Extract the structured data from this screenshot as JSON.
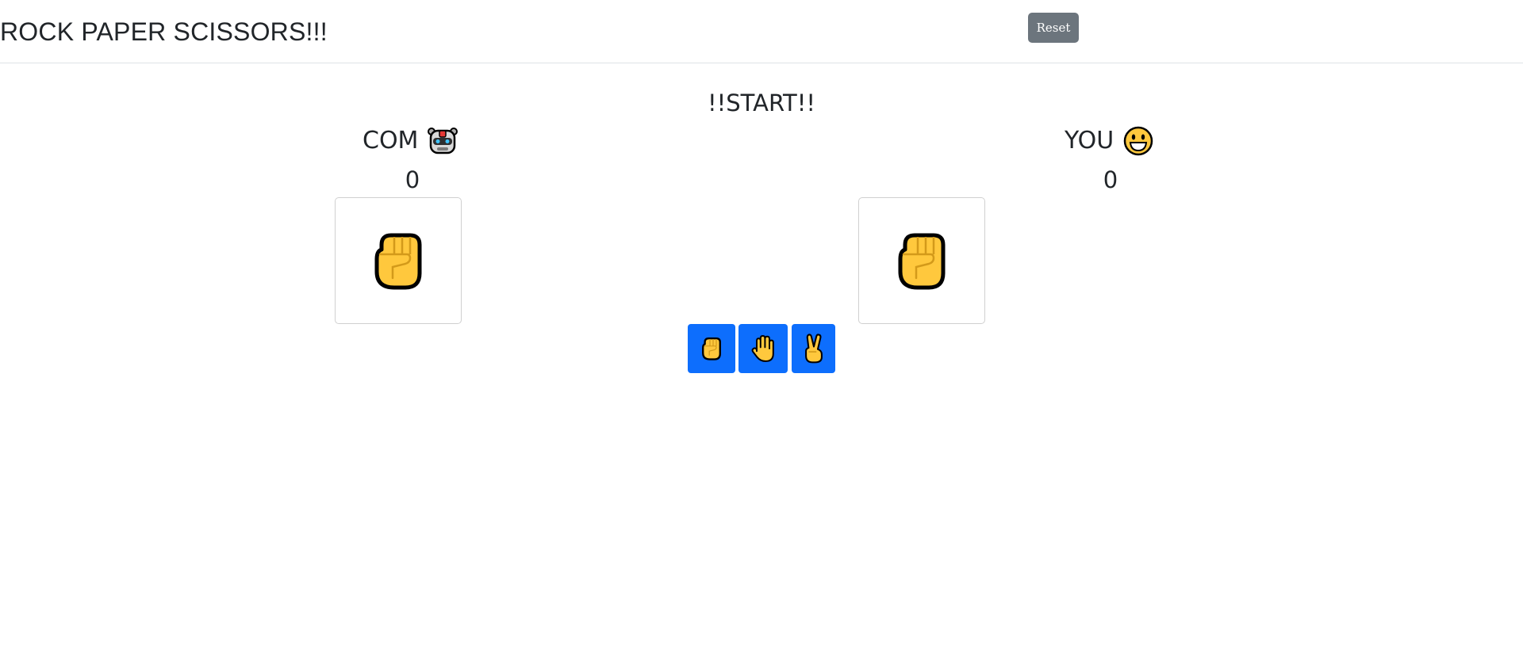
{
  "header": {
    "title": "ROCK PAPER SCISSORS!!!",
    "reset_label": "Reset"
  },
  "status": "!!START!!",
  "computer": {
    "label": "COM",
    "avatar_icon": "robot-face-icon",
    "score": "0",
    "hand": "rock-fist-icon"
  },
  "player": {
    "label": "YOU",
    "avatar_icon": "grinning-face-icon",
    "score": "0",
    "hand": "rock-fist-icon"
  },
  "choices": [
    {
      "name": "rock",
      "icon": "raised-fist-icon"
    },
    {
      "name": "paper",
      "icon": "raised-hand-icon"
    },
    {
      "name": "scissors",
      "icon": "victory-hand-icon"
    }
  ],
  "colors": {
    "primary": "#0d6efd",
    "secondary": "#6c757d",
    "emoji_yellow": "#FFC83D",
    "emoji_outline": "#000000"
  }
}
